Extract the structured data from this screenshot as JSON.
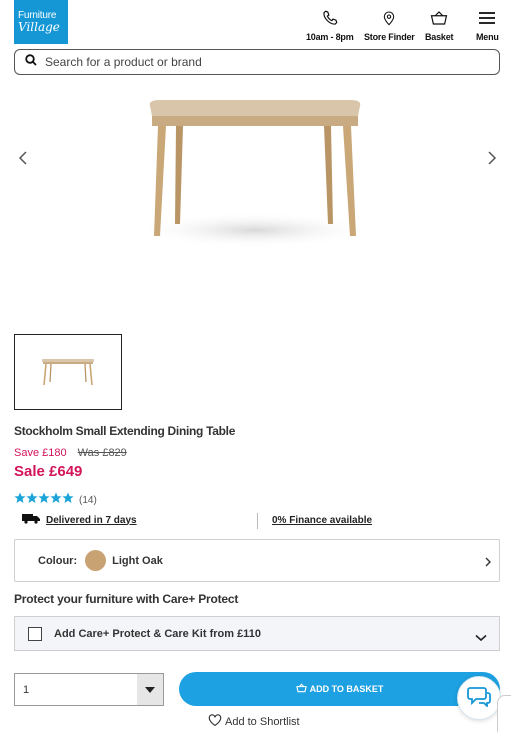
{
  "header": {
    "logo_line1": "Furniture",
    "logo_line2": "Village",
    "items": [
      {
        "icon": "phone-icon",
        "label": "10am - 8pm"
      },
      {
        "icon": "map-pin-icon",
        "label": "Store Finder"
      },
      {
        "icon": "basket-icon",
        "label": "Basket"
      },
      {
        "icon": "menu-icon",
        "label": "Menu"
      }
    ]
  },
  "search": {
    "placeholder": "Search for a product or brand"
  },
  "product": {
    "title": "Stockholm Small Extending Dining Table",
    "save": "Save £180",
    "was": "Was £829",
    "price": "Sale £649",
    "rating": 5,
    "review_count": "(14)",
    "delivery": "Delivered in 7 days",
    "finance": "0% Finance available"
  },
  "colour": {
    "label": "Colour:",
    "value": "Light Oak",
    "swatch": "#c9a273"
  },
  "protect": {
    "title": "Protect your furniture with Care+ Protect",
    "option": "Add Care+ Protect & Care Kit from £110"
  },
  "purchase": {
    "quantity": "1",
    "add_to_basket": "ADD TO BASKET",
    "shortlist": "Add to Shortlist"
  },
  "colors": {
    "brand": "#1597d6",
    "sale": "#d4145a",
    "button": "#1da1e2",
    "star": "#1ba4d8"
  }
}
